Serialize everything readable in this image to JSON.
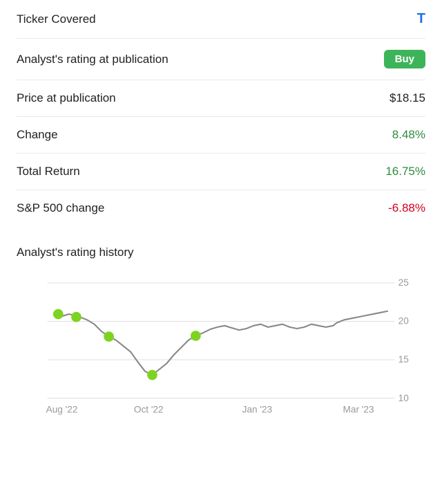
{
  "rows": [
    {
      "id": "ticker",
      "label": "Ticker Covered",
      "value": "T",
      "valueClass": "blue"
    },
    {
      "id": "rating",
      "label": "Analyst's rating at publication",
      "value": "Buy",
      "valueClass": "badge"
    },
    {
      "id": "price",
      "label": "Price at publication",
      "value": "$18.15",
      "valueClass": ""
    },
    {
      "id": "change",
      "label": "Change",
      "value": "8.48%",
      "valueClass": "green"
    },
    {
      "id": "total-return",
      "label": "Total Return",
      "value": "16.75%",
      "valueClass": "green"
    },
    {
      "id": "sp500",
      "label": "S&P 500 change",
      "value": "-6.88%",
      "valueClass": "red"
    }
  ],
  "chart": {
    "title": "Analyst's rating history",
    "yLabels": [
      "25",
      "20",
      "15",
      "10"
    ],
    "xLabels": [
      "Aug '22",
      "Oct '22",
      "Jan '23",
      "Mar '23"
    ],
    "gridLines": [
      25,
      20,
      15,
      10
    ],
    "yMin": 10,
    "yMax": 26,
    "color": "#888",
    "dotColor": "#7ed321"
  }
}
